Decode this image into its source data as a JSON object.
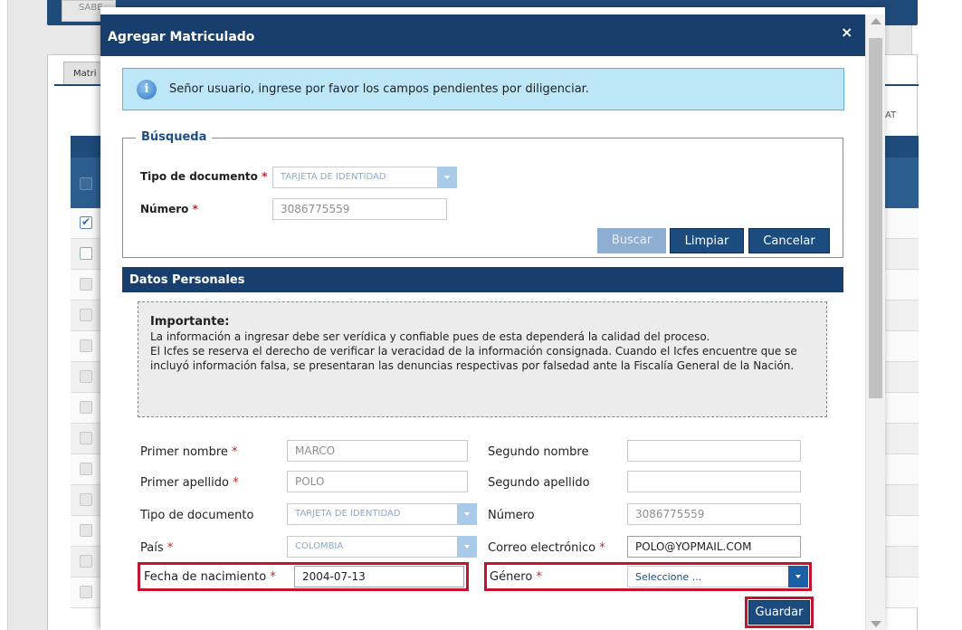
{
  "background": {
    "top_tab_label": "SABE",
    "tab_label": "Matri",
    "side_text": "AT"
  },
  "modal": {
    "title": "Agregar Matriculado",
    "close_glyph": "×"
  },
  "info_banner": {
    "icon_glyph": "i",
    "text": "Señor usuario, ingrese por favor los campos pendientes por diligenciar."
  },
  "search": {
    "legend": "Búsqueda",
    "doc_type_label": "Tipo de documento",
    "doc_type_value": "TARJETA DE IDENTIDAD",
    "number_label": "Número",
    "number_value": "3086775559",
    "required_mark": "*",
    "buttons": {
      "search": "Buscar",
      "clear": "Limpiar",
      "cancel": "Cancelar"
    }
  },
  "personal": {
    "header": "Datos Personales",
    "notice_title": "Importante:",
    "notice_line1": "La información a ingresar debe ser verídica y confiable pues de esta dependerá la calidad del proceso.",
    "notice_line2": "El Icfes se reserva el derecho de verificar la veracidad de la información consignada. Cuando el Icfes encuentre que se incluyó información falsa, se presentaran las denuncias respectivas por falsedad ante la Fiscalía General de la Nación.",
    "fields": {
      "first_name_label": "Primer nombre",
      "first_name_value": "MARCO",
      "second_name_label": "Segundo nombre",
      "second_name_value": "",
      "first_surname_label": "Primer apellido",
      "first_surname_value": "POLO",
      "second_surname_label": "Segundo apellido",
      "second_surname_value": "",
      "doc_type_label": "Tipo de documento",
      "doc_type_value": "TARJETA DE IDENTIDAD",
      "number_label": "Número",
      "number_value": "3086775559",
      "country_label": "País",
      "country_value": "COLOMBIA",
      "email_label": "Correo electrónico",
      "email_value": "POLO@YOPMAIL.COM",
      "birth_label": "Fecha de nacimiento",
      "birth_value": "2004-07-13",
      "gender_label": "Género",
      "gender_value": "Seleccione ..."
    },
    "save_label": "Guardar"
  },
  "colors": {
    "header_navy": "#173e6c",
    "highlight_red": "#c4122f",
    "info_bg": "#bde7f6"
  }
}
